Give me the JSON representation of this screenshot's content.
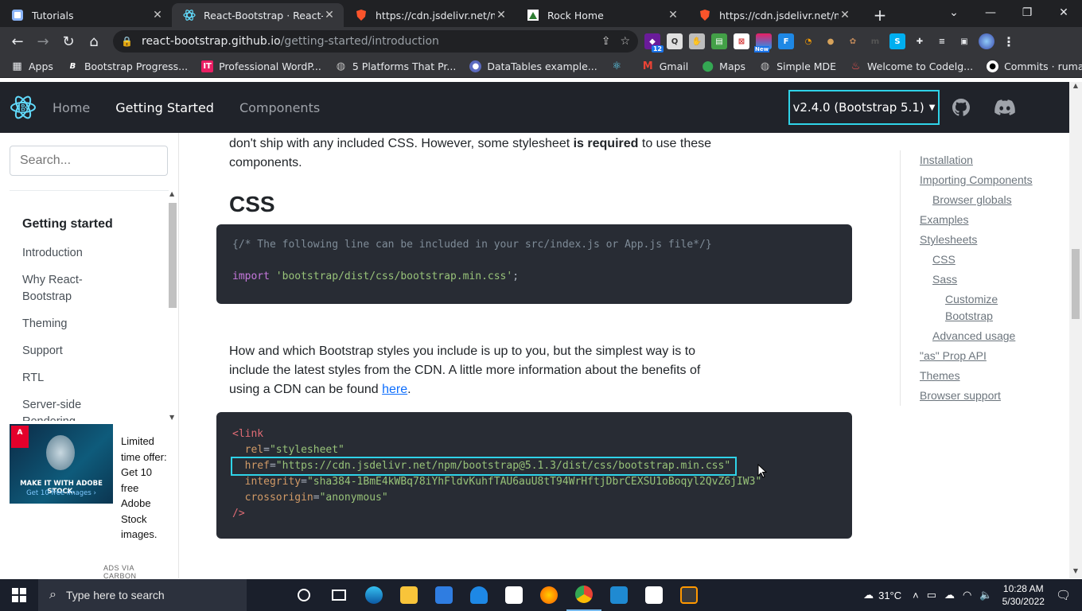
{
  "browser": {
    "tabs": [
      {
        "title": "Tutorials",
        "active": false,
        "icon": "tutorials-icon"
      },
      {
        "title": "React-Bootstrap · React-Boot",
        "active": true,
        "icon": "react-bootstrap-icon"
      },
      {
        "title": "https://cdn.jsdelivr.net/npm/",
        "active": false,
        "icon": "shield-icon"
      },
      {
        "title": "Rock Home",
        "active": false,
        "icon": "rock-icon"
      },
      {
        "title": "https://cdn.jsdelivr.net/npm/",
        "active": false,
        "icon": "shield-icon"
      }
    ],
    "url_host": "react-bootstrap.github.io",
    "url_path": "/getting-started/introduction",
    "ext_badge": "12",
    "ext_new": "New",
    "bookmarks": [
      {
        "label": "Apps"
      },
      {
        "label": "Bootstrap Progress..."
      },
      {
        "label": "Professional WordP..."
      },
      {
        "label": "5 Platforms That Pr..."
      },
      {
        "label": "DataTables example..."
      },
      {
        "label": ""
      },
      {
        "label": "Gmail"
      },
      {
        "label": "Maps"
      },
      {
        "label": "Simple MDE"
      },
      {
        "label": "Welcome to Codelg..."
      },
      {
        "label": "Commits · rumanpa..."
      }
    ]
  },
  "site": {
    "nav": [
      "Home",
      "Getting Started",
      "Components"
    ],
    "version": "v2.4.0 (Bootstrap 5.1)",
    "search_placeholder": "Search...",
    "sidebar_heading": "Getting started",
    "sidebar_items": [
      "Introduction",
      "Why React-Bootstrap",
      "Theming",
      "Support",
      "RTL",
      "Server-side Rendering"
    ],
    "ad": {
      "text": "Limited time offer: Get 10 free Adobe Stock images.",
      "footer": "ADS VIA CARBON",
      "image_line1": "MAKE IT WITH ADOBE STOCK.",
      "image_line2": "Get 10 free images ›"
    }
  },
  "content": {
    "intro_1": "don't ship with any included CSS. However, some stylesheet ",
    "intro_bold": "is required",
    "intro_2": " to use these components.",
    "css_heading": "CSS",
    "code1": {
      "comment": "{/* The following line can be included in your src/index.js or App.js file*/}",
      "keyword": "import",
      "string": "'bootstrap/dist/css/bootstrap.min.css'",
      "end": ";"
    },
    "para2_1": "How and which Bootstrap styles you include is up to you, but the simplest way is to include the latest styles from the CDN. A little more information about the benefits of using a CDN can be found ",
    "para2_link": "here",
    "para2_end": ".",
    "code2": {
      "open": "<link",
      "rel_attr": "rel",
      "rel_val": "\"stylesheet\"",
      "href_attr": "href",
      "href_val": "\"https://cdn.jsdelivr.net/npm/bootstrap@5.1.3/dist/css/bootstrap.min.css\"",
      "integrity_attr": "integrity",
      "integrity_val": "\"sha384-1BmE4kWBq78iYhFldvKuhfTAU6auU8tT94WrHftjDbrCEXSU1oBoqyl2QvZ6jIW3\"",
      "cross_attr": "crossorigin",
      "cross_val": "\"anonymous\"",
      "close": "/>"
    },
    "toc": [
      {
        "label": "Installation",
        "level": 1
      },
      {
        "label": "Importing Components",
        "level": 1
      },
      {
        "label": "Browser globals",
        "level": 2
      },
      {
        "label": "Examples",
        "level": 1
      },
      {
        "label": "Stylesheets",
        "level": 1
      },
      {
        "label": "CSS",
        "level": 2
      },
      {
        "label": "Sass",
        "level": 2
      },
      {
        "label": "Customize Bootstrap",
        "level": 3
      },
      {
        "label": "Advanced usage",
        "level": 2
      },
      {
        "label": "\"as\" Prop API",
        "level": 1
      },
      {
        "label": "Themes",
        "level": 1
      },
      {
        "label": "Browser support",
        "level": 1
      }
    ]
  },
  "taskbar": {
    "search_placeholder": "Type here to search",
    "weather": "31°C",
    "time": "10:28 AM",
    "date": "5/30/2022"
  },
  "colors": {
    "highlight": "#2fd3e8",
    "navbar": "#20232a",
    "code_bg": "#282c34",
    "react_blue": "#61dafb"
  }
}
